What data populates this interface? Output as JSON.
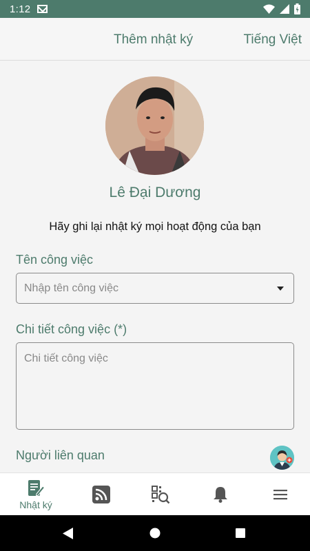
{
  "status_bar": {
    "time": "1:12"
  },
  "header": {
    "title": "Thêm nhật ký",
    "language": "Tiếng Việt"
  },
  "profile": {
    "name": "Lê Đại Dương",
    "subtitle": "Hãy ghi lại nhật ký mọi hoạt động của bạn"
  },
  "form": {
    "task_name_label": "Tên công việc",
    "task_name_placeholder": "Nhập tên công việc",
    "task_detail_label": "Chi tiết công việc (*)",
    "task_detail_placeholder": "Chi tiết công việc",
    "related_label": "Người liên quan"
  },
  "bottom_nav": {
    "items": [
      {
        "label": "Nhật ký",
        "icon": "journal-edit-icon",
        "active": true
      },
      {
        "label": "",
        "icon": "rss-feed-icon",
        "active": false
      },
      {
        "label": "",
        "icon": "qr-scan-icon",
        "active": false
      },
      {
        "label": "",
        "icon": "bell-icon",
        "active": false
      },
      {
        "label": "",
        "icon": "menu-icon",
        "active": false
      }
    ]
  },
  "colors": {
    "primary": "#4d7b6c",
    "icon_gray": "#555555",
    "background": "#f4f4f4",
    "status_bar": "#4d7b6c"
  }
}
